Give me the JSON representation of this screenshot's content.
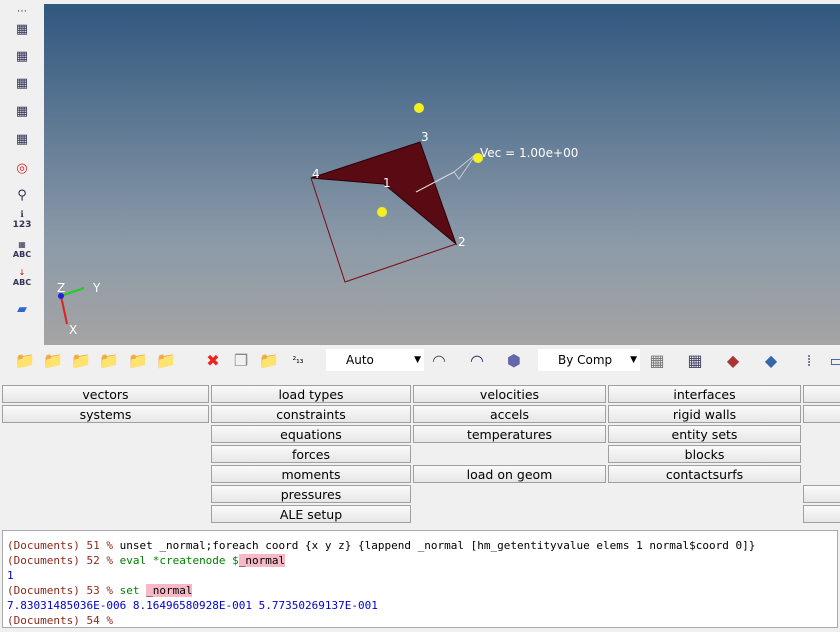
{
  "left_toolbar": {
    "icons": [
      "view-cube-icon",
      "rotate-icon",
      "fit-icon",
      "mesh-icon",
      "section-icon",
      "isolate-icon",
      "find-icon",
      "info-123-icon",
      "abc-icon",
      "abc-arrow-icon",
      "plane-icon"
    ],
    "labels": [
      "123",
      "ABC",
      "ABC"
    ]
  },
  "viewport": {
    "node_labels": [
      "1",
      "2",
      "3",
      "4"
    ],
    "vector_label": "Vec = 1.00e+00",
    "axes": {
      "x": "X",
      "y": "Y",
      "z": "Z"
    },
    "fill_color": "#5a0a12"
  },
  "toolbar": {
    "geom_color_mode": "Auto",
    "elem_color_mode": "By Comp"
  },
  "panel": {
    "col1": [
      "vectors",
      "systems"
    ],
    "col2": [
      "load types",
      "constraints",
      "equations",
      "forces",
      "moments",
      "pressures",
      "ALE setup"
    ],
    "col3": [
      "velocities",
      "accels",
      "temperatures",
      "",
      "load on geom"
    ],
    "col4": [
      "interfaces",
      "rigid walls",
      "entity sets",
      "blocks",
      "contactsurfs"
    ]
  },
  "console": {
    "lines": [
      {
        "prompt": "(Documents) 51 %",
        "cmd": "unset _normal;foreach coord {x y z} {lappend _normal [hm_getentityvalue elems 1 normal$coord 0]}"
      },
      {
        "prompt": "(Documents) 52 %",
        "cmd": "eval *createnode $",
        "hl": "_normal"
      },
      {
        "out": "1"
      },
      {
        "prompt": "(Documents) 53 %",
        "cmd": "set ",
        "hl": "_normal"
      },
      {
        "out": "7.83031485036E-006 8.16496580928E-001 5.77350269137E-001"
      },
      {
        "prompt": "(Documents) 54 %",
        "cmd": ""
      }
    ]
  }
}
